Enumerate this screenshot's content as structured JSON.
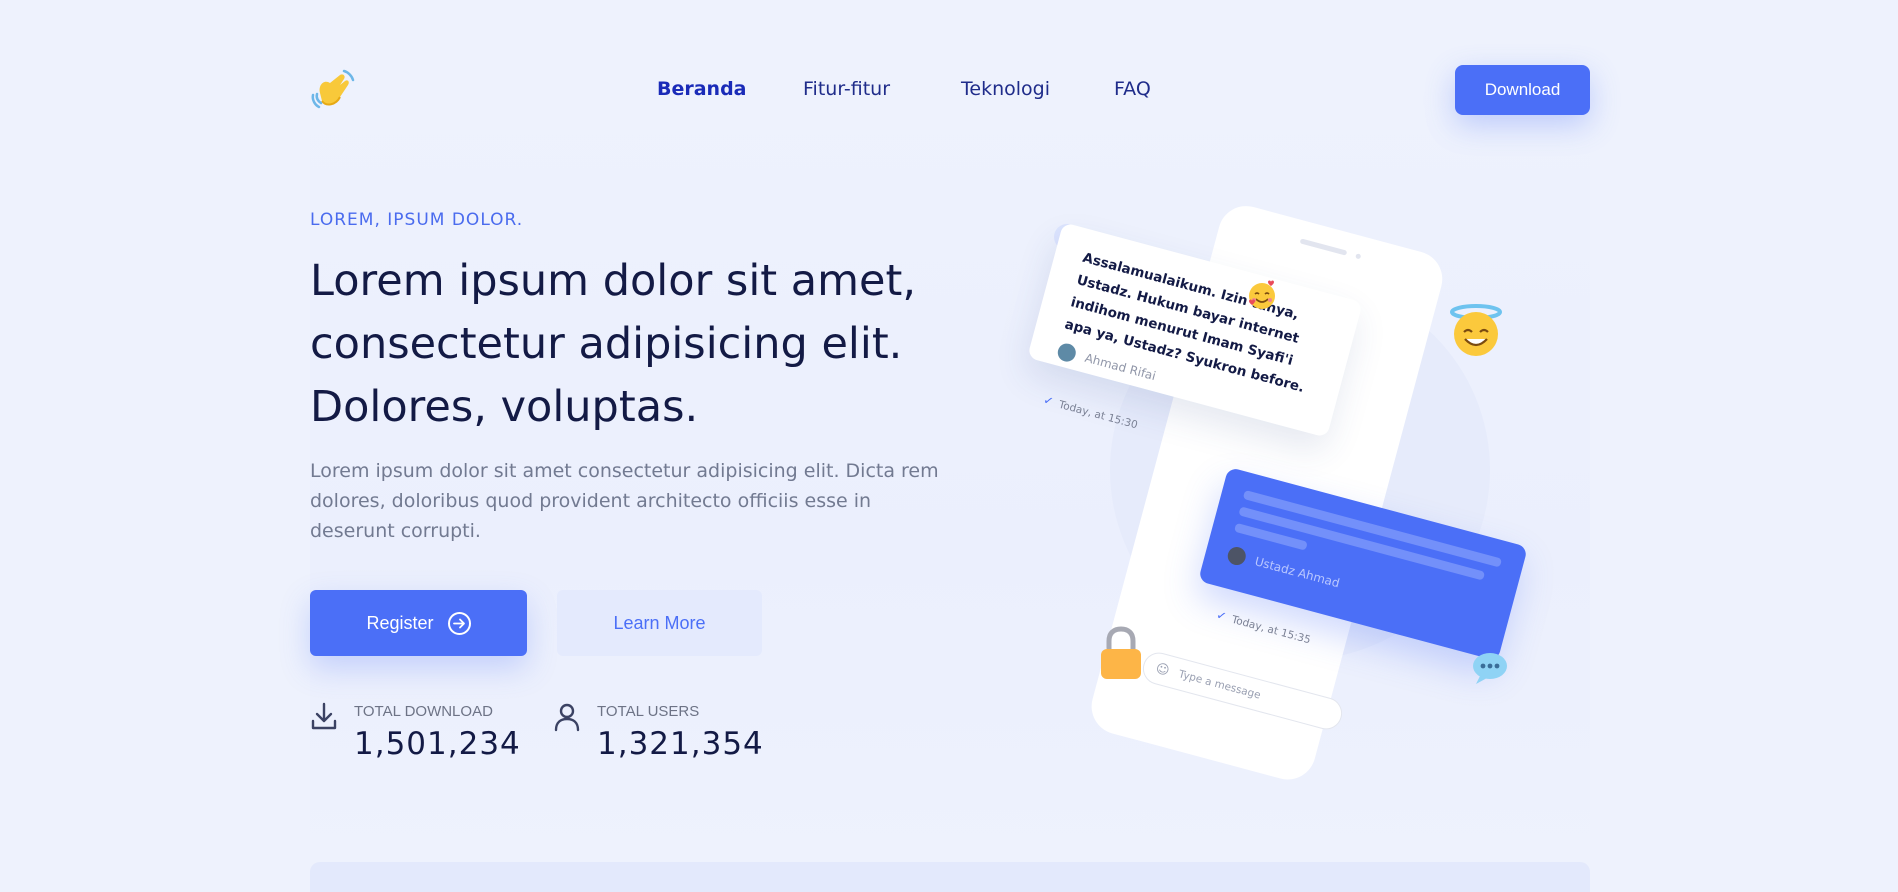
{
  "header": {
    "logo_icon": "waving-hand-icon",
    "nav": [
      {
        "label": "Beranda",
        "active": true
      },
      {
        "label": "Fitur-fitur",
        "active": false
      },
      {
        "label": "Teknologi",
        "active": false
      },
      {
        "label": "FAQ",
        "active": false
      }
    ],
    "download_label": "Download"
  },
  "hero": {
    "eyebrow": "LOREM, IPSUM DOLOR.",
    "headline_lines": [
      "Lorem ipsum dolor sit amet,",
      "consectetur adipisicing elit.",
      "Dolores, voluptas."
    ],
    "lead_text": "Lorem ipsum dolor sit amet consectetur adipisicing elit. Dicta rem dolores, doloribus quod provident architecto officiis esse in deserunt corrupti.",
    "register_label": "Register",
    "learn_more_label": "Learn More"
  },
  "stats": [
    {
      "icon": "download-icon",
      "label": "TOTAL DOWNLOAD",
      "value": "1,501,234"
    },
    {
      "icon": "user-icon",
      "label": "TOTAL USERS",
      "value": "1,321,354"
    }
  ],
  "illustration": {
    "message_in": "Assalamualaikum. Izin tanya, Ustadz. Hukum bayar internet indihom menurut Imam Syafi'i apa ya, Ustadz? Syukron before.",
    "message_in_author": "Ahmad Rifai",
    "message_in_time": "Today, at 15:30",
    "message_out_author": "Ustadz Ahmad",
    "message_out_time": "Today, at 15:35",
    "input_placeholder": "Type a message"
  },
  "colors": {
    "accent": "#4b6ff7",
    "background": "#eef2fd",
    "heading": "#131a45",
    "body_text": "#727a91"
  }
}
